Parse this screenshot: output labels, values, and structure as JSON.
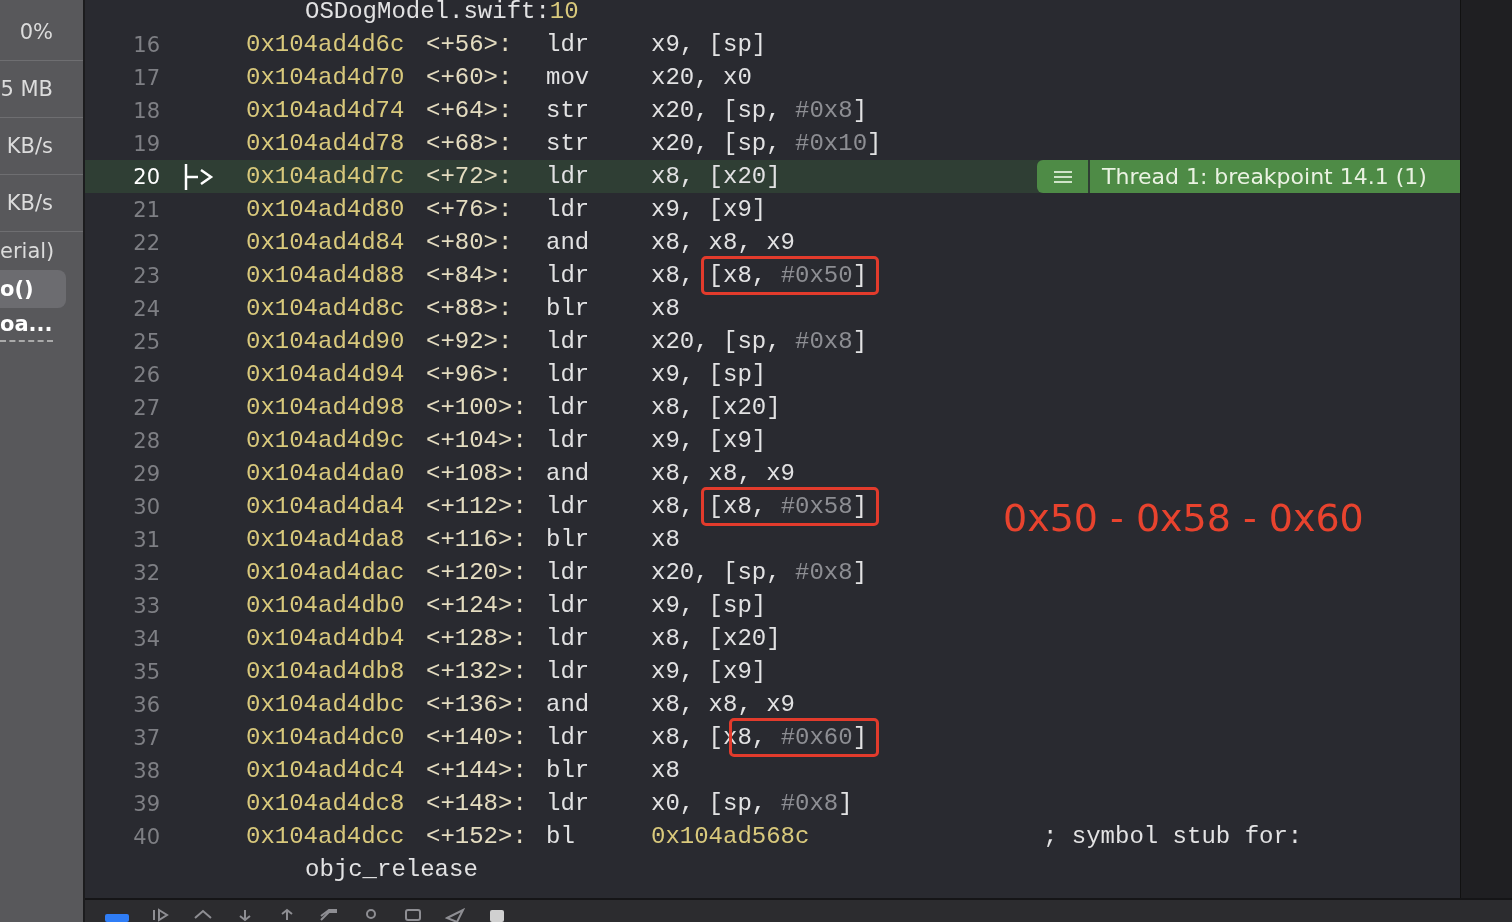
{
  "sidebar": {
    "items": [
      {
        "text": "0%",
        "kind": "metric",
        "selected": false
      },
      {
        "text": "5 MB",
        "kind": "metric",
        "selected": false
      },
      {
        "text": "KB/s",
        "kind": "metric",
        "selected": false
      },
      {
        "text": "KB/s",
        "kind": "metric",
        "selected": false
      },
      {
        "text": "erial)",
        "kind": "frame",
        "selected": false
      },
      {
        "text": "o()",
        "kind": "frame",
        "selected": true
      },
      {
        "text": "oa...",
        "kind": "hint",
        "selected": false
      }
    ]
  },
  "editor": {
    "header": {
      "file": "OSDogModel.swift:",
      "line": "10"
    },
    "rows": [
      {
        "number": "16",
        "address": "0x104ad4d6c",
        "offset": "<+56>:",
        "mnemonic": "ldr",
        "current": false,
        "operands": [
          {
            "text": "x9, [sp]",
            "kind": "reg",
            "boxed": false
          }
        ]
      },
      {
        "number": "17",
        "address": "0x104ad4d70",
        "offset": "<+60>:",
        "mnemonic": "mov",
        "current": false,
        "operands": [
          {
            "text": "x20, x0",
            "kind": "reg",
            "boxed": false
          }
        ]
      },
      {
        "number": "18",
        "address": "0x104ad4d74",
        "offset": "<+64>:",
        "mnemonic": "str",
        "current": false,
        "operands": [
          {
            "text": "x20, [sp, ",
            "kind": "reg",
            "boxed": false
          },
          {
            "text": "#0x8",
            "kind": "imm",
            "boxed": false
          },
          {
            "text": "]",
            "kind": "reg",
            "boxed": false
          }
        ]
      },
      {
        "number": "19",
        "address": "0x104ad4d78",
        "offset": "<+68>:",
        "mnemonic": "str",
        "current": false,
        "operands": [
          {
            "text": "x20, [sp, ",
            "kind": "reg",
            "boxed": false
          },
          {
            "text": "#0x10",
            "kind": "imm",
            "boxed": false
          },
          {
            "text": "]",
            "kind": "reg",
            "boxed": false
          }
        ]
      },
      {
        "number": "20",
        "address": "0x104ad4d7c",
        "offset": "<+72>:",
        "mnemonic": "ldr",
        "current": true,
        "badge": "Thread 1: breakpoint 14.1 (1)",
        "operands": [
          {
            "text": "x8, [x20]",
            "kind": "reg",
            "boxed": false
          }
        ]
      },
      {
        "number": "21",
        "address": "0x104ad4d80",
        "offset": "<+76>:",
        "mnemonic": "ldr",
        "current": false,
        "operands": [
          {
            "text": "x9, [x9]",
            "kind": "reg",
            "boxed": false
          }
        ]
      },
      {
        "number": "22",
        "address": "0x104ad4d84",
        "offset": "<+80>:",
        "mnemonic": "and",
        "current": false,
        "operands": [
          {
            "text": "x8, x8, x9",
            "kind": "reg",
            "boxed": false
          }
        ]
      },
      {
        "number": "23",
        "address": "0x104ad4d88",
        "offset": "<+84>:",
        "mnemonic": "ldr",
        "current": false,
        "operands": [
          {
            "text": "x8, ",
            "kind": "reg",
            "boxed": false
          },
          {
            "text": "[x8, ",
            "kind": "reg",
            "boxed": true
          },
          {
            "text": "#0x50",
            "kind": "imm",
            "boxed": true
          },
          {
            "text": "]",
            "kind": "reg",
            "boxed": true
          }
        ]
      },
      {
        "number": "24",
        "address": "0x104ad4d8c",
        "offset": "<+88>:",
        "mnemonic": "blr",
        "current": false,
        "operands": [
          {
            "text": "x8",
            "kind": "reg",
            "boxed": false
          }
        ]
      },
      {
        "number": "25",
        "address": "0x104ad4d90",
        "offset": "<+92>:",
        "mnemonic": "ldr",
        "current": false,
        "operands": [
          {
            "text": "x20, [sp, ",
            "kind": "reg",
            "boxed": false
          },
          {
            "text": "#0x8",
            "kind": "imm",
            "boxed": false
          },
          {
            "text": "]",
            "kind": "reg",
            "boxed": false
          }
        ]
      },
      {
        "number": "26",
        "address": "0x104ad4d94",
        "offset": "<+96>:",
        "mnemonic": "ldr",
        "current": false,
        "operands": [
          {
            "text": "x9, [sp]",
            "kind": "reg",
            "boxed": false
          }
        ]
      },
      {
        "number": "27",
        "address": "0x104ad4d98",
        "offset": "<+100>:",
        "mnemonic": "ldr",
        "current": false,
        "operands": [
          {
            "text": "x8, [x20]",
            "kind": "reg",
            "boxed": false
          }
        ]
      },
      {
        "number": "28",
        "address": "0x104ad4d9c",
        "offset": "<+104>:",
        "mnemonic": "ldr",
        "current": false,
        "operands": [
          {
            "text": "x9, [x9]",
            "kind": "reg",
            "boxed": false
          }
        ]
      },
      {
        "number": "29",
        "address": "0x104ad4da0",
        "offset": "<+108>:",
        "mnemonic": "and",
        "current": false,
        "operands": [
          {
            "text": "x8, x8, x9",
            "kind": "reg",
            "boxed": false
          }
        ]
      },
      {
        "number": "30",
        "address": "0x104ad4da4",
        "offset": "<+112>:",
        "mnemonic": "ldr",
        "current": false,
        "operands": [
          {
            "text": "x8, ",
            "kind": "reg",
            "boxed": false
          },
          {
            "text": "[x8, ",
            "kind": "reg",
            "boxed": true
          },
          {
            "text": "#0x58",
            "kind": "imm",
            "boxed": true
          },
          {
            "text": "]",
            "kind": "reg",
            "boxed": true
          }
        ]
      },
      {
        "number": "31",
        "address": "0x104ad4da8",
        "offset": "<+116>:",
        "mnemonic": "blr",
        "current": false,
        "operands": [
          {
            "text": "x8",
            "kind": "reg",
            "boxed": false
          }
        ]
      },
      {
        "number": "32",
        "address": "0x104ad4dac",
        "offset": "<+120>:",
        "mnemonic": "ldr",
        "current": false,
        "operands": [
          {
            "text": "x20, [sp, ",
            "kind": "reg",
            "boxed": false
          },
          {
            "text": "#0x8",
            "kind": "imm",
            "boxed": false
          },
          {
            "text": "]",
            "kind": "reg",
            "boxed": false
          }
        ]
      },
      {
        "number": "33",
        "address": "0x104ad4db0",
        "offset": "<+124>:",
        "mnemonic": "ldr",
        "current": false,
        "operands": [
          {
            "text": "x9, [sp]",
            "kind": "reg",
            "boxed": false
          }
        ]
      },
      {
        "number": "34",
        "address": "0x104ad4db4",
        "offset": "<+128>:",
        "mnemonic": "ldr",
        "current": false,
        "operands": [
          {
            "text": "x8, [x20]",
            "kind": "reg",
            "boxed": false
          }
        ]
      },
      {
        "number": "35",
        "address": "0x104ad4db8",
        "offset": "<+132>:",
        "mnemonic": "ldr",
        "current": false,
        "operands": [
          {
            "text": "x9, [x9]",
            "kind": "reg",
            "boxed": false
          }
        ]
      },
      {
        "number": "36",
        "address": "0x104ad4dbc",
        "offset": "<+136>:",
        "mnemonic": "and",
        "current": false,
        "operands": [
          {
            "text": "x8, x8, x9",
            "kind": "reg",
            "boxed": false
          }
        ]
      },
      {
        "number": "37",
        "address": "0x104ad4dc0",
        "offset": "<+140>:",
        "mnemonic": "ldr",
        "current": false,
        "operands": [
          {
            "text": "x8, [x",
            "kind": "reg",
            "boxed": false
          },
          {
            "text": "8, ",
            "kind": "reg",
            "boxed": true
          },
          {
            "text": "#0x60",
            "kind": "imm",
            "boxed": true
          },
          {
            "text": "]",
            "kind": "reg",
            "boxed": true
          }
        ]
      },
      {
        "number": "38",
        "address": "0x104ad4dc4",
        "offset": "<+144>:",
        "mnemonic": "blr",
        "current": false,
        "operands": [
          {
            "text": "x8",
            "kind": "reg",
            "boxed": false
          }
        ]
      },
      {
        "number": "39",
        "address": "0x104ad4dc8",
        "offset": "<+148>:",
        "mnemonic": "ldr",
        "current": false,
        "operands": [
          {
            "text": "x0, [sp, ",
            "kind": "reg",
            "boxed": false
          },
          {
            "text": "#0x8",
            "kind": "imm",
            "boxed": false
          },
          {
            "text": "]",
            "kind": "reg",
            "boxed": false
          }
        ]
      },
      {
        "number": "40",
        "address": "0x104ad4dcc",
        "offset": "<+152>:",
        "mnemonic": "bl",
        "current": false,
        "comment": "; symbol stub for:",
        "continuation": "objc_release",
        "operands": [
          {
            "text": "0x104ad568c",
            "kind": "addr",
            "boxed": false
          }
        ]
      }
    ],
    "annotation": "0x50 - 0x58 - 0x60"
  }
}
